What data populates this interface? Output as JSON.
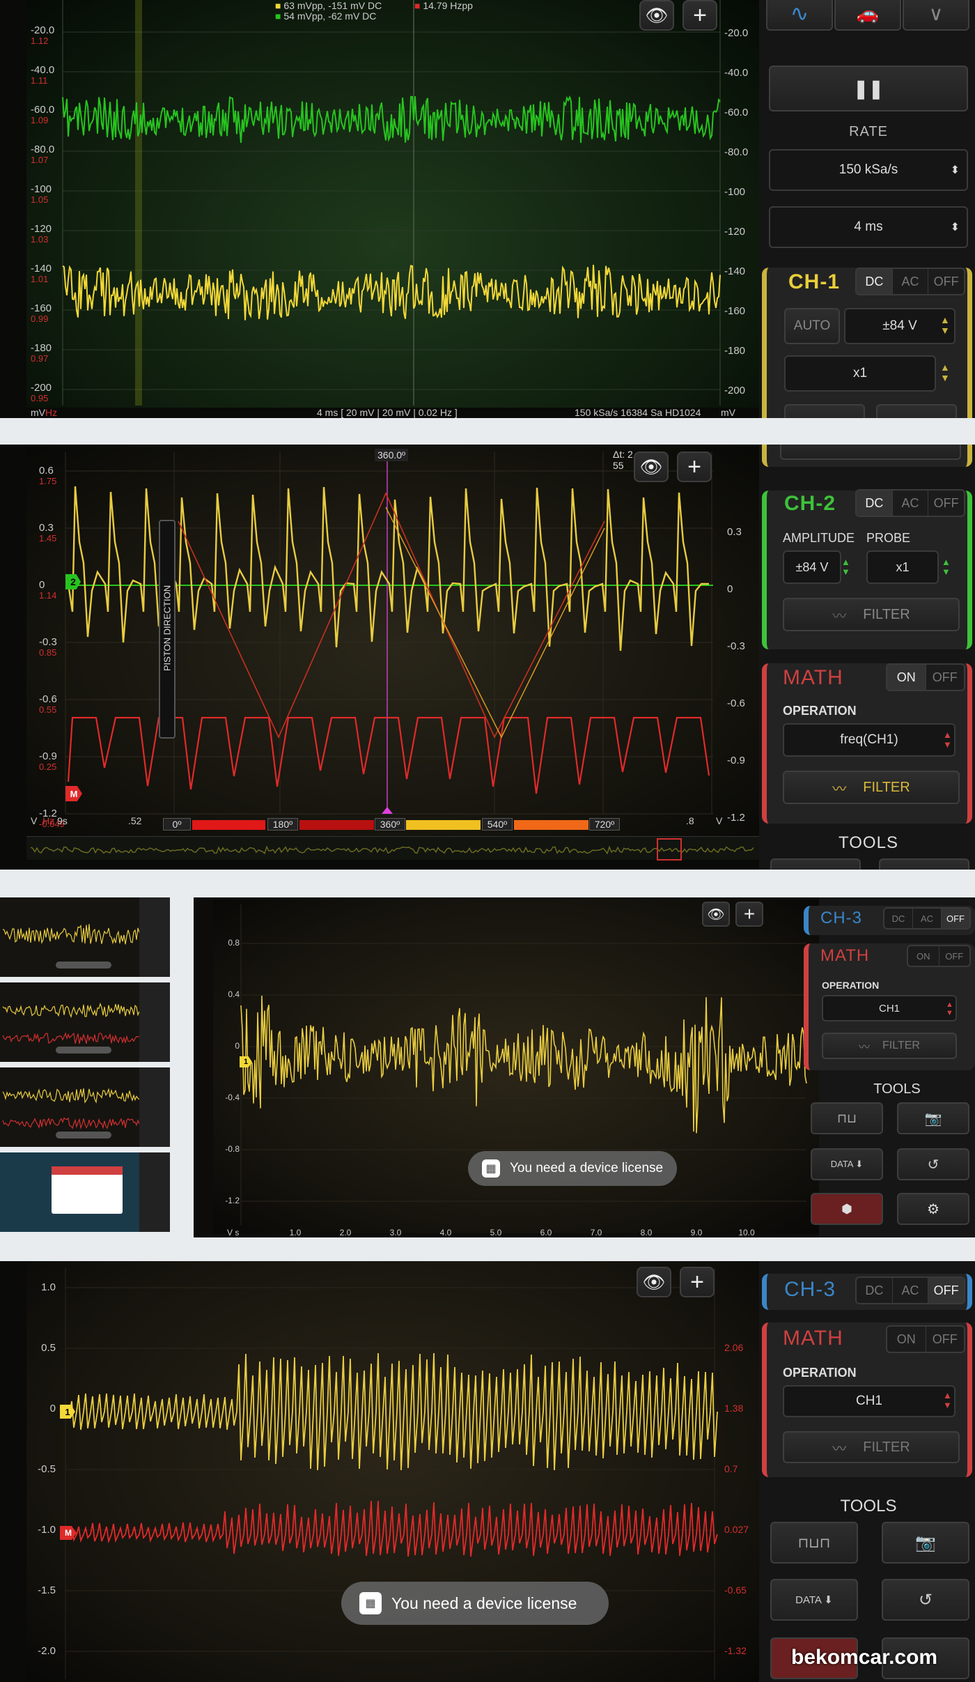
{
  "panel1": {
    "legend": {
      "ch1": "63 mVpp, -151 mV DC",
      "ch2": "54 mVpp, -62 mV DC",
      "math": "14.79 Hzpp"
    },
    "left_axis": [
      [
        "-20.0",
        "1.12"
      ],
      [
        "-40.0",
        "1.11"
      ],
      [
        "-60.0",
        "1.09"
      ],
      [
        "-80.0",
        "1.07"
      ],
      [
        "-100",
        "1.05"
      ],
      [
        "-120",
        "1.03"
      ],
      [
        "-140",
        "1.01"
      ],
      [
        "-160",
        "0.99"
      ],
      [
        "-180",
        "0.97"
      ],
      [
        "-200",
        "0.95"
      ]
    ],
    "right_axis": [
      "-20.0",
      "-40.0",
      "-60.0",
      "-80.0",
      "-100",
      "-120",
      "-140",
      "-160",
      "-180",
      "-200"
    ],
    "unit_left": "mV",
    "unit_left2": "Hz",
    "unit_right": "mV",
    "footer": "4 ms  [ 20 mV | 20 mV | 0.02 Hz ]",
    "footer_right": "150 kSa/s   16384 Sa   HD1024",
    "rate_label": "RATE",
    "rate_value": "150 kSa/s",
    "timebase": "4 ms",
    "ch1": {
      "title": "CH-1",
      "coupling": [
        "DC",
        "AC",
        "OFF"
      ],
      "auto": "AUTO",
      "range": "±84 V",
      "probe": "x1"
    }
  },
  "panel2": {
    "cursor_label": "360.0º",
    "dt_label": "Δt: 2",
    "dt_sub": "55",
    "left_axis": [
      [
        "0.6",
        "1.75"
      ],
      [
        "0.3",
        "1.45"
      ],
      [
        "0",
        "1.14"
      ],
      [
        "-0.3",
        "0.85"
      ],
      [
        "-0.6",
        "0.55"
      ],
      [
        "-0.9",
        "0.25"
      ],
      [
        "-1.2",
        "-0.049"
      ]
    ],
    "right_axis": [
      "0.3",
      "0",
      "-0.3",
      "-0.6",
      "-0.9",
      "-1.2"
    ],
    "piston": "PISTON DIRECTION",
    "bottom_left": "V   Hz  9s",
    "bottom_tick": ".52",
    "bottom_tick2": ".8",
    "bottom_unit": "V",
    "degrees": [
      "0º",
      "180º",
      "360º",
      "540º",
      "720º"
    ],
    "ch2": {
      "title": "CH-2",
      "coupling": [
        "DC",
        "AC",
        "OFF"
      ],
      "amp_label": "AMPLITUDE",
      "probe_label": "PROBE",
      "range": "±84 V",
      "probe": "x1",
      "filter": "FILTER"
    },
    "math": {
      "title": "MATH",
      "state": [
        "ON",
        "OFF"
      ],
      "op_label": "OPERATION",
      "op": "freq(CH1)",
      "filter": "FILTER"
    },
    "tools": "TOOLS",
    "marker_ch": "2",
    "marker_math": "M"
  },
  "panel3": {
    "yaxis": [
      "0.8",
      "0.4",
      "0",
      "-0.4",
      "-0.8",
      "-1.2"
    ],
    "xaxis": [
      "1.0",
      "2.0",
      "3.0",
      "4.0",
      "5.0",
      "6.0",
      "7.0",
      "8.0",
      "9.0",
      "10.0"
    ],
    "xunit": "V  s",
    "toast": "You need a device license",
    "ch3": {
      "title": "CH-3",
      "coupling": [
        "DC",
        "AC",
        "OFF"
      ]
    },
    "math": {
      "title": "MATH",
      "state": [
        "ON",
        "OFF"
      ],
      "op_label": "OPERATION",
      "op": "CH1",
      "filter": "FILTER"
    },
    "tools": "TOOLS",
    "data_btn": "DATA ⬇",
    "marker": "1"
  },
  "panel4": {
    "left_axis": [
      "1.0",
      "0.5",
      "0",
      "-0.5",
      "-1.0",
      "-1.5",
      "-2.0"
    ],
    "right_axis": [
      "2.06",
      "1.38",
      "0.7",
      "0.027",
      "-0.65",
      "-1.32"
    ],
    "toast": "You need a device license",
    "ch3": {
      "title": "CH-3",
      "coupling": [
        "DC",
        "AC",
        "OFF"
      ]
    },
    "math": {
      "title": "MATH",
      "state": [
        "ON",
        "OFF"
      ],
      "op_label": "OPERATION",
      "op": "CH1",
      "filter": "FILTER"
    },
    "tools": "TOOLS",
    "data_btn": "DATA ⬇",
    "watermark": "bekomcar.com",
    "marker_ch": "1",
    "marker_math": "M"
  },
  "colors": {
    "ch1": "#f2d838",
    "ch2": "#27c41f",
    "math": "#e02a2a",
    "ch3": "#3a86c8"
  }
}
